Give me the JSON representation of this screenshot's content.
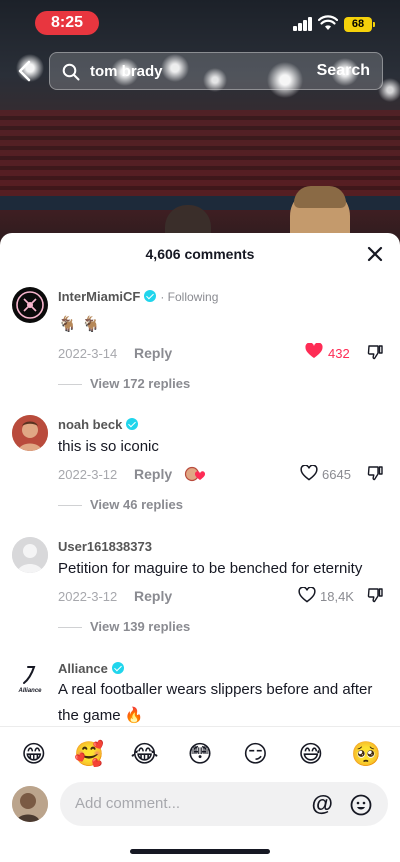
{
  "status_bar": {
    "time": "8:25",
    "battery": "68"
  },
  "header": {
    "search_query": "tom brady",
    "search_button": "Search"
  },
  "comments_panel": {
    "title": "4,606 comments",
    "comments": [
      {
        "username": "InterMiamiCF",
        "following_label": "· Following",
        "text": "🐐 🐐",
        "date": "2022-3-14",
        "reply_label": "Reply",
        "likes": "432",
        "liked": true,
        "view_replies": "View 172 replies"
      },
      {
        "username": "noah beck",
        "text": "this is so iconic",
        "date": "2022-3-12",
        "reply_label": "Reply",
        "likes": "6645",
        "liked": false,
        "view_replies": "View 46 replies"
      },
      {
        "username": "User161838373",
        "text": "Petition for maguire to be benched for eternity",
        "date": "2022-3-12",
        "reply_label": "Reply",
        "likes": "18,4K",
        "liked": false,
        "view_replies": "View 139 replies"
      },
      {
        "username": "Alliance",
        "avatar_text": "Alliance",
        "text": "A real footballer wears slippers before and after the game 🔥"
      }
    ]
  },
  "emoji_bar": [
    "😁",
    "🥰",
    "😂",
    "😳",
    "😏",
    "😅",
    "🥺"
  ],
  "composer": {
    "placeholder": "Add comment...",
    "at_symbol": "@"
  },
  "colors": {
    "like_active": "#fe2c55",
    "verified": "#20d5ec",
    "time_pill": "#e8363f",
    "battery": "#f5d10a"
  }
}
